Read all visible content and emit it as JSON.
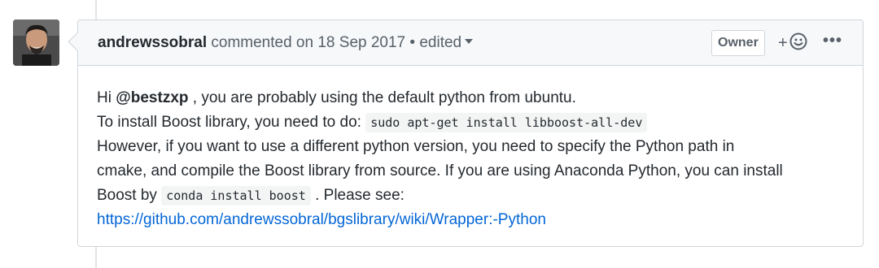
{
  "comment": {
    "author": "andrewssobral",
    "action": "commented on",
    "date": "18 Sep 2017",
    "separator": "•",
    "edited_label": "edited",
    "owner_badge": "Owner",
    "reaction_plus": "+",
    "more_label": "•••",
    "body": {
      "line1_pre": "Hi ",
      "mention": "@bestzxp",
      "line1_post": " , you are probably using the default python from ubuntu.",
      "line2_pre": "To install Boost library, you need to do: ",
      "code1": "sudo apt-get install libboost-all-dev",
      "line3": "However, if you want to use a different python version, you need to specify the Python path in",
      "line4": "cmake, and compile the Boost library from source. If you are using Anaconda Python, you can install",
      "line5_pre": "Boost by ",
      "code2": "conda install boost",
      "line5_post": " . Please see:",
      "link": "https://github.com/andrewssobral/bgslibrary/wiki/Wrapper:-Python"
    }
  },
  "icons": {
    "avatar": "user-avatar",
    "reaction": "smiley-icon",
    "caret": "caret-down-icon",
    "more": "kebab-horizontal-icon"
  },
  "colors": {
    "link": "#0366d6",
    "header_bg": "#f6f8fa",
    "border": "#d1d5da",
    "muted_text": "#586069"
  }
}
